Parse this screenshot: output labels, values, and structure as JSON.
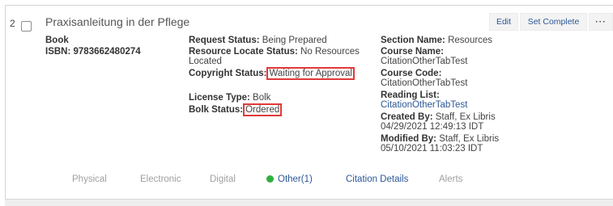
{
  "row": {
    "number": "2",
    "title": "Praxisanleitung in der Pflege"
  },
  "actions": {
    "edit": "Edit",
    "set_complete": "Set Complete",
    "more": "···"
  },
  "item": {
    "type": "Book",
    "isbn_label": "ISBN:",
    "isbn_value": "9783662480274"
  },
  "status": {
    "request_label": "Request Status:",
    "request_value": "Being Prepared",
    "locate_label": "Resource Locate Status:",
    "locate_value_1": "No Resources",
    "locate_value_2": "Located",
    "copyright_label": "Copyright Status:",
    "copyright_value": "Waiting for Approval",
    "license_label": "License Type:",
    "license_value": "Bolk",
    "bolk_label": "Bolk Status:",
    "bolk_value": "Ordered"
  },
  "section": {
    "section_label": "Section Name:",
    "section_value": "Resources",
    "course_name_label": "Course Name:",
    "course_name_value": "CitationOtherTabTest",
    "course_code_label": "Course Code:",
    "course_code_value": "CitationOtherTabTest",
    "reading_list_label": "Reading List:",
    "reading_list_value": "CitationOtherTabTest",
    "created_label": "Created By:",
    "created_by": "Staff, Ex Libris",
    "created_date": "04/29/2021 12:49:13 IDT",
    "modified_label": "Modified By:",
    "modified_by": "Staff, Ex Libris",
    "modified_date": "05/10/2021 11:03:23 IDT"
  },
  "tabs": {
    "physical": "Physical",
    "electronic": "Electronic",
    "digital": "Digital",
    "other": "Other(1)",
    "citation_details": "Citation Details",
    "alerts": "Alerts"
  },
  "colors": {
    "link": "#2b5797",
    "highlight": "#e03a3a",
    "status_dot": "#2fb13f"
  }
}
